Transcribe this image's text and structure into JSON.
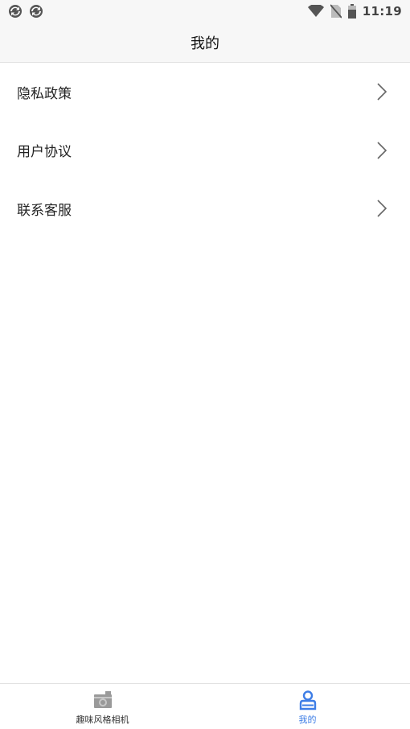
{
  "status_bar": {
    "time": "11:19",
    "left_icons": [
      "sync-icon",
      "sync-icon"
    ],
    "right_icons": [
      "wifi-icon",
      "no-sim-icon",
      "battery-icon"
    ]
  },
  "header": {
    "title": "我的"
  },
  "menu": {
    "items": [
      {
        "label": "隐私政策",
        "icon": "chevron-right-icon"
      },
      {
        "label": "用户协议",
        "icon": "chevron-right-icon"
      },
      {
        "label": "联系客服",
        "icon": "chevron-right-icon"
      }
    ]
  },
  "tab_bar": {
    "tabs": [
      {
        "label": "趣味风格相机",
        "icon": "camera-icon",
        "active": false
      },
      {
        "label": "我的",
        "icon": "user-icon",
        "active": true
      }
    ]
  },
  "colors": {
    "accent": "#3d7de6",
    "header_bg": "#f7f7f7",
    "divider": "#e2e2e2",
    "inactive_icon": "#9a9a9a"
  }
}
